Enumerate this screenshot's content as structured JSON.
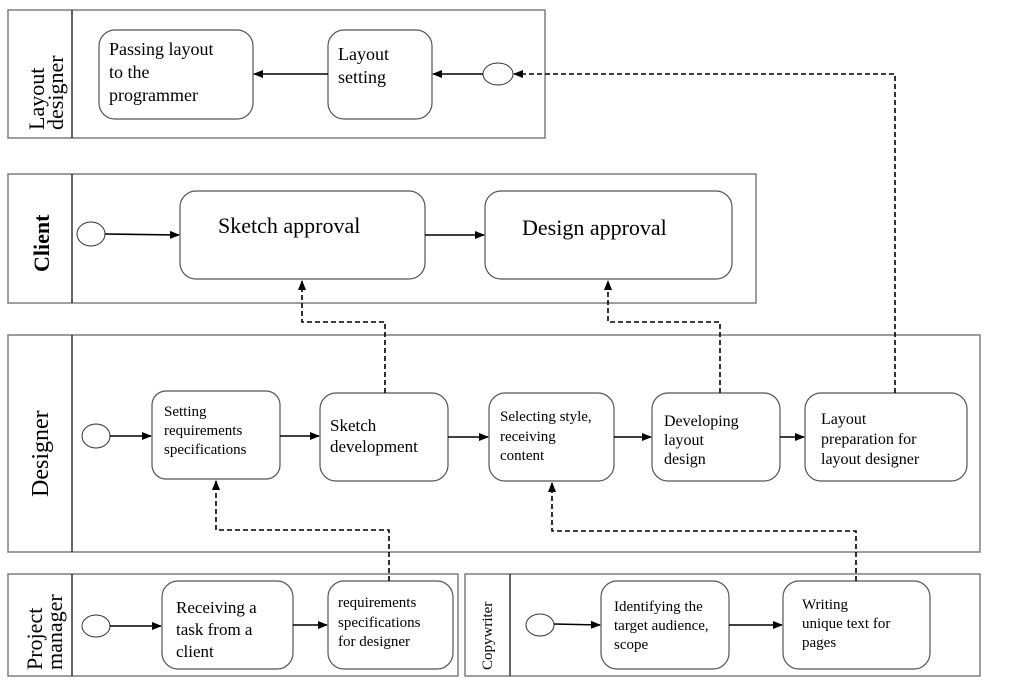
{
  "lanes": {
    "layout_designer": {
      "label_line1": "Layout",
      "label_line2": "designer"
    },
    "client": {
      "label": "Client"
    },
    "designer": {
      "label": "Designer"
    },
    "project_manager": {
      "label_line1": "Project",
      "label_line2": "manager"
    },
    "copywriter": {
      "label": "Copywriter"
    }
  },
  "tasks": {
    "passing_layout": [
      "Passing layout",
      "to the",
      "programmer"
    ],
    "layout_setting": [
      "Layout",
      "setting"
    ],
    "sketch_approval": [
      "Sketch approval"
    ],
    "design_approval": [
      "Design approval"
    ],
    "setting_requirements": [
      "Setting",
      "requirements",
      "specifications"
    ],
    "sketch_development": [
      "Sketch",
      "development"
    ],
    "selecting_style": [
      "Selecting style,",
      "receiving",
      "content"
    ],
    "developing_layout": [
      "Developing",
      "layout",
      "design"
    ],
    "layout_preparation": [
      "Layout",
      "preparation for",
      "layout designer"
    ],
    "receiving_task": [
      "Receiving a",
      "task from a",
      "client"
    ],
    "requirements_for_designer": [
      "requirements",
      "specifications",
      "for designer"
    ],
    "identifying_audience": [
      "Identifying the",
      "target audience,",
      "scope"
    ],
    "writing_text": [
      "Writing",
      "unique text for",
      "pages"
    ]
  },
  "colors": {
    "lane_border": "#7f7f7f",
    "box_border": "#555555",
    "arrow": "#000000"
  }
}
